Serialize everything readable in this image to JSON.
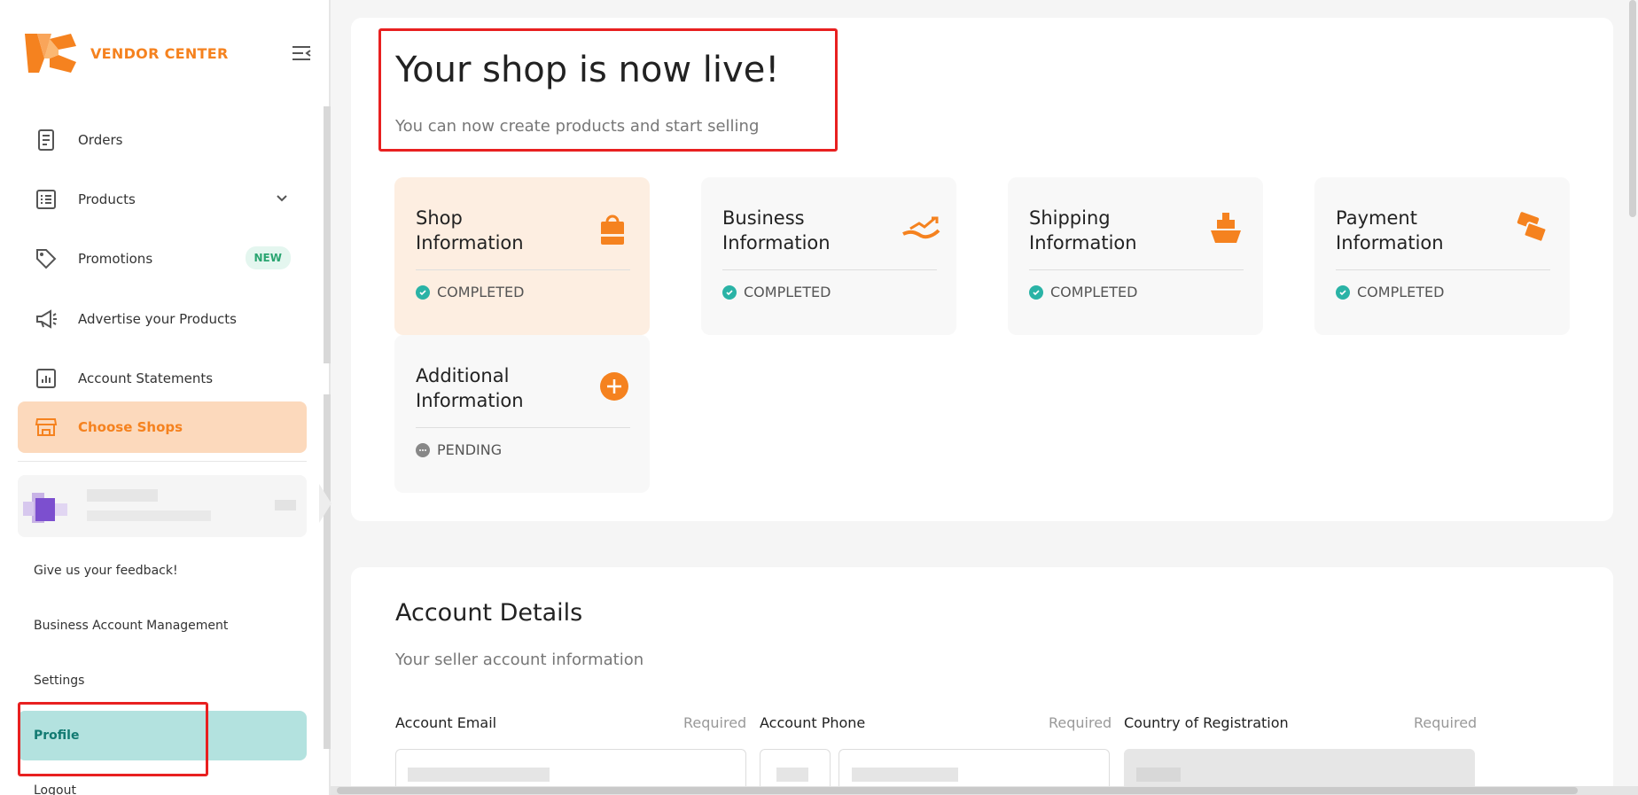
{
  "brand": {
    "name": "VENDOR CENTER",
    "color": "#f5821f"
  },
  "sidebar": {
    "items": [
      {
        "label": "Orders",
        "icon": "receipt-icon"
      },
      {
        "label": "Products",
        "icon": "list-icon"
      },
      {
        "label": "Promotions",
        "icon": "tag-icon",
        "badge": "NEW"
      },
      {
        "label": "Advertise your Products",
        "icon": "megaphone-icon"
      },
      {
        "label": "Account Statements",
        "icon": "chart-icon"
      },
      {
        "label": "Choose Shops",
        "icon": "store-icon",
        "active": true
      }
    ],
    "links": [
      {
        "label": "Give us your feedback!"
      },
      {
        "label": "Business Account Management"
      },
      {
        "label": "Settings"
      },
      {
        "label": "Profile",
        "active": true
      },
      {
        "label": "Logout"
      }
    ]
  },
  "hero": {
    "title": "Your shop is now live!",
    "subtitle": "You can now create products and start selling"
  },
  "tiles": [
    {
      "title": "Shop Information",
      "status": "COMPLETED",
      "icon": "shopping-bag-icon"
    },
    {
      "title": "Business Information",
      "status": "COMPLETED",
      "icon": "growth-hand-icon"
    },
    {
      "title": "Shipping Information",
      "status": "COMPLETED",
      "icon": "ship-icon"
    },
    {
      "title": "Payment Information",
      "status": "COMPLETED",
      "icon": "cards-icon"
    },
    {
      "title": "Additional Information",
      "status": "PENDING",
      "icon": "plus-circle-icon"
    }
  ],
  "account": {
    "title": "Account Details",
    "subtitle": "Your seller account information",
    "fields": [
      {
        "label": "Account Email",
        "required": "Required"
      },
      {
        "label": "Account Phone",
        "required": "Required"
      },
      {
        "label": "Country of Registration",
        "required": "Required"
      }
    ]
  },
  "colors": {
    "accent": "#f5821f",
    "success": "#2ab3a6",
    "pending": "#888888",
    "highlight": "#e82020"
  }
}
